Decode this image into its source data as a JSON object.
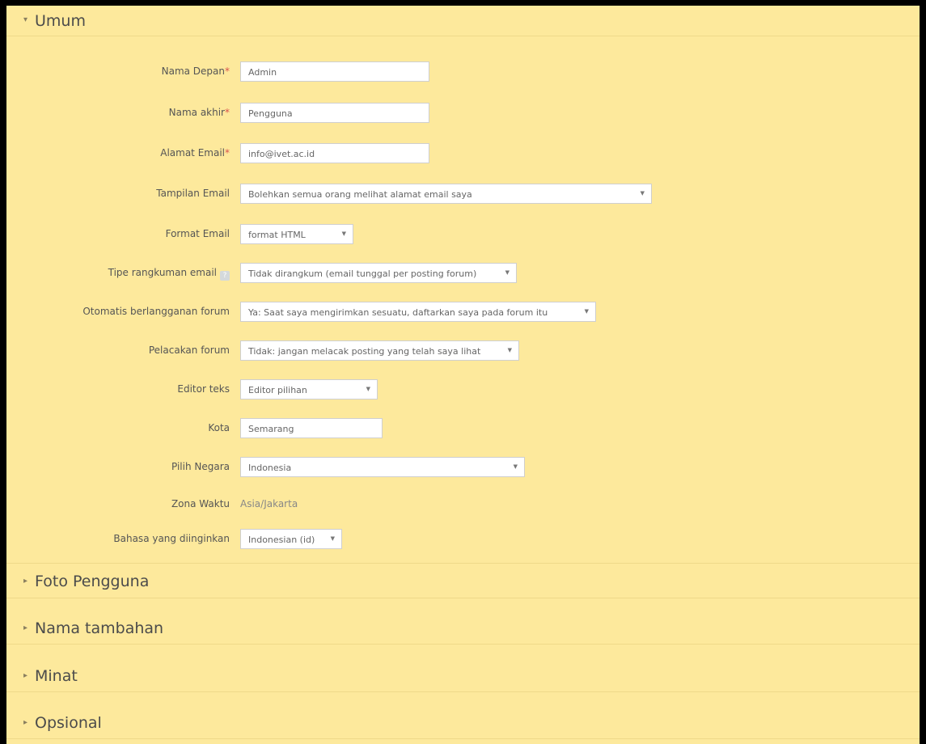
{
  "sections": {
    "umum": "Umum",
    "foto": "Foto Pengguna",
    "nama_tambahan": "Nama tambahan",
    "minat": "Minat",
    "opsional": "Opsional"
  },
  "required_marker": "*",
  "form": {
    "nama_depan": {
      "label": "Nama Depan",
      "value": "Admin"
    },
    "nama_akhir": {
      "label": "Nama akhir",
      "value": "Pengguna"
    },
    "alamat_email": {
      "label": "Alamat Email",
      "value": "info@ivet.ac.id"
    },
    "tampilan_email": {
      "label": "Tampilan Email",
      "value": "Bolehkan semua orang melihat alamat email saya"
    },
    "format_email": {
      "label": "Format Email",
      "value": "format HTML"
    },
    "tipe_rangkuman": {
      "label": "Tipe rangkuman email",
      "value": "Tidak dirangkum (email tunggal per posting forum)"
    },
    "otomatis_berlangganan": {
      "label": "Otomatis berlangganan forum",
      "value": "Ya: Saat saya mengirimkan sesuatu, daftarkan saya pada forum itu"
    },
    "pelacakan_forum": {
      "label": "Pelacakan forum",
      "value": "Tidak: jangan melacak posting yang telah saya lihat"
    },
    "editor_teks": {
      "label": "Editor teks",
      "value": "Editor pilihan"
    },
    "kota": {
      "label": "Kota",
      "value": "Semarang"
    },
    "pilih_negara": {
      "label": "Pilih Negara",
      "value": "Indonesia"
    },
    "zona_waktu": {
      "label": "Zona Waktu",
      "value": "Asia/Jakarta"
    },
    "bahasa": {
      "label": "Bahasa yang diinginkan",
      "value": "Indonesian (id)"
    }
  },
  "icons": {
    "expanded": "caret-down-icon",
    "collapsed": "caret-right-icon",
    "select_arrow": "chevron-down-icon",
    "help": "help-icon"
  }
}
